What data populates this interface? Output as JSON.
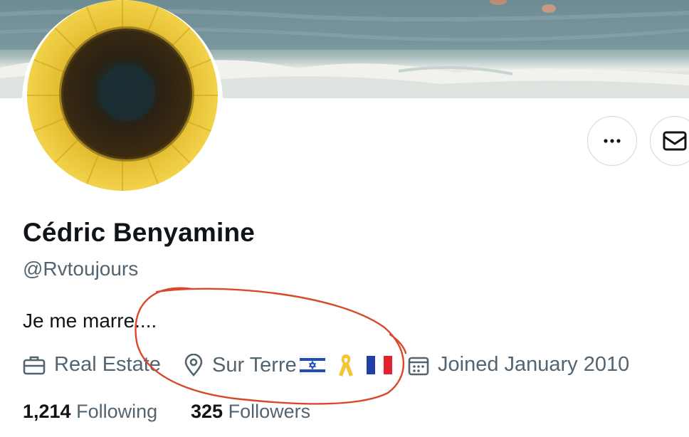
{
  "profile": {
    "name": "Cédric Benyamine",
    "handle": "@Rvtoujours",
    "bio": "Je me marre....",
    "category": "Real Estate",
    "location": "Sur Terre",
    "location_emojis": [
      "israel-flag",
      "yellow-ribbon",
      "france-flag"
    ],
    "joined": "Joined January 2010",
    "following_count": "1,214",
    "following_label": "Following",
    "followers_count": "325",
    "followers_label": "Followers"
  },
  "icons": {
    "more": "more-options-icon",
    "message": "mail-icon",
    "category": "briefcase-icon",
    "location": "location-pin-icon",
    "joined": "calendar-icon"
  },
  "colors": {
    "text": "#0f1419",
    "secondary": "#536471",
    "annotation": "#d9482a",
    "border": "#cfd9de"
  }
}
